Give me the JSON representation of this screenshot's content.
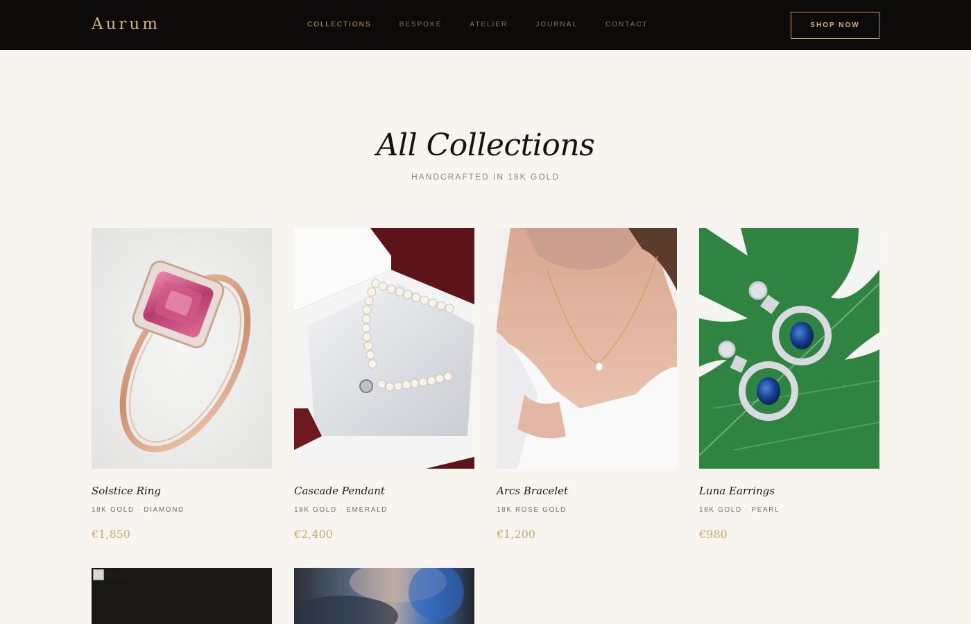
{
  "brand": {
    "name": "Aurum"
  },
  "nav": {
    "links": [
      {
        "label": "COLLECTIONS",
        "active": true
      },
      {
        "label": "BESPOKE"
      },
      {
        "label": "ATELIER"
      },
      {
        "label": "JOURNAL"
      },
      {
        "label": "CONTACT"
      }
    ],
    "cta": "SHOP NOW"
  },
  "page": {
    "title": "All Collections",
    "subtitle": "HANDCRAFTED IN 18K GOLD"
  },
  "products": [
    {
      "name": "Solstice Ring",
      "meta": "18K GOLD · DIAMOND",
      "price": "€1,850",
      "image": "pink-gem-ring-photo"
    },
    {
      "name": "Cascade Pendant",
      "meta": "18K GOLD · EMERALD",
      "price": "€2,400",
      "image": "pearl-necklace-box-photo"
    },
    {
      "name": "Arcs Bracelet",
      "meta": "18K ROSE GOLD",
      "price": "€1,200",
      "image": "woman-pearl-pendant-photo"
    },
    {
      "name": "Luna Earrings",
      "meta": "18K GOLD · PEARL",
      "price": "€980",
      "image": "sapphire-earrings-leaf-photo"
    }
  ],
  "products_row2": [
    {
      "image_alt": "Ring",
      "image": "broken-image"
    },
    {
      "image": "blurred-photo"
    }
  ],
  "colors": {
    "nav_bg": "#0d0b09",
    "accent_gold": "#c5a76a",
    "page_bg": "#f8f5f0"
  }
}
